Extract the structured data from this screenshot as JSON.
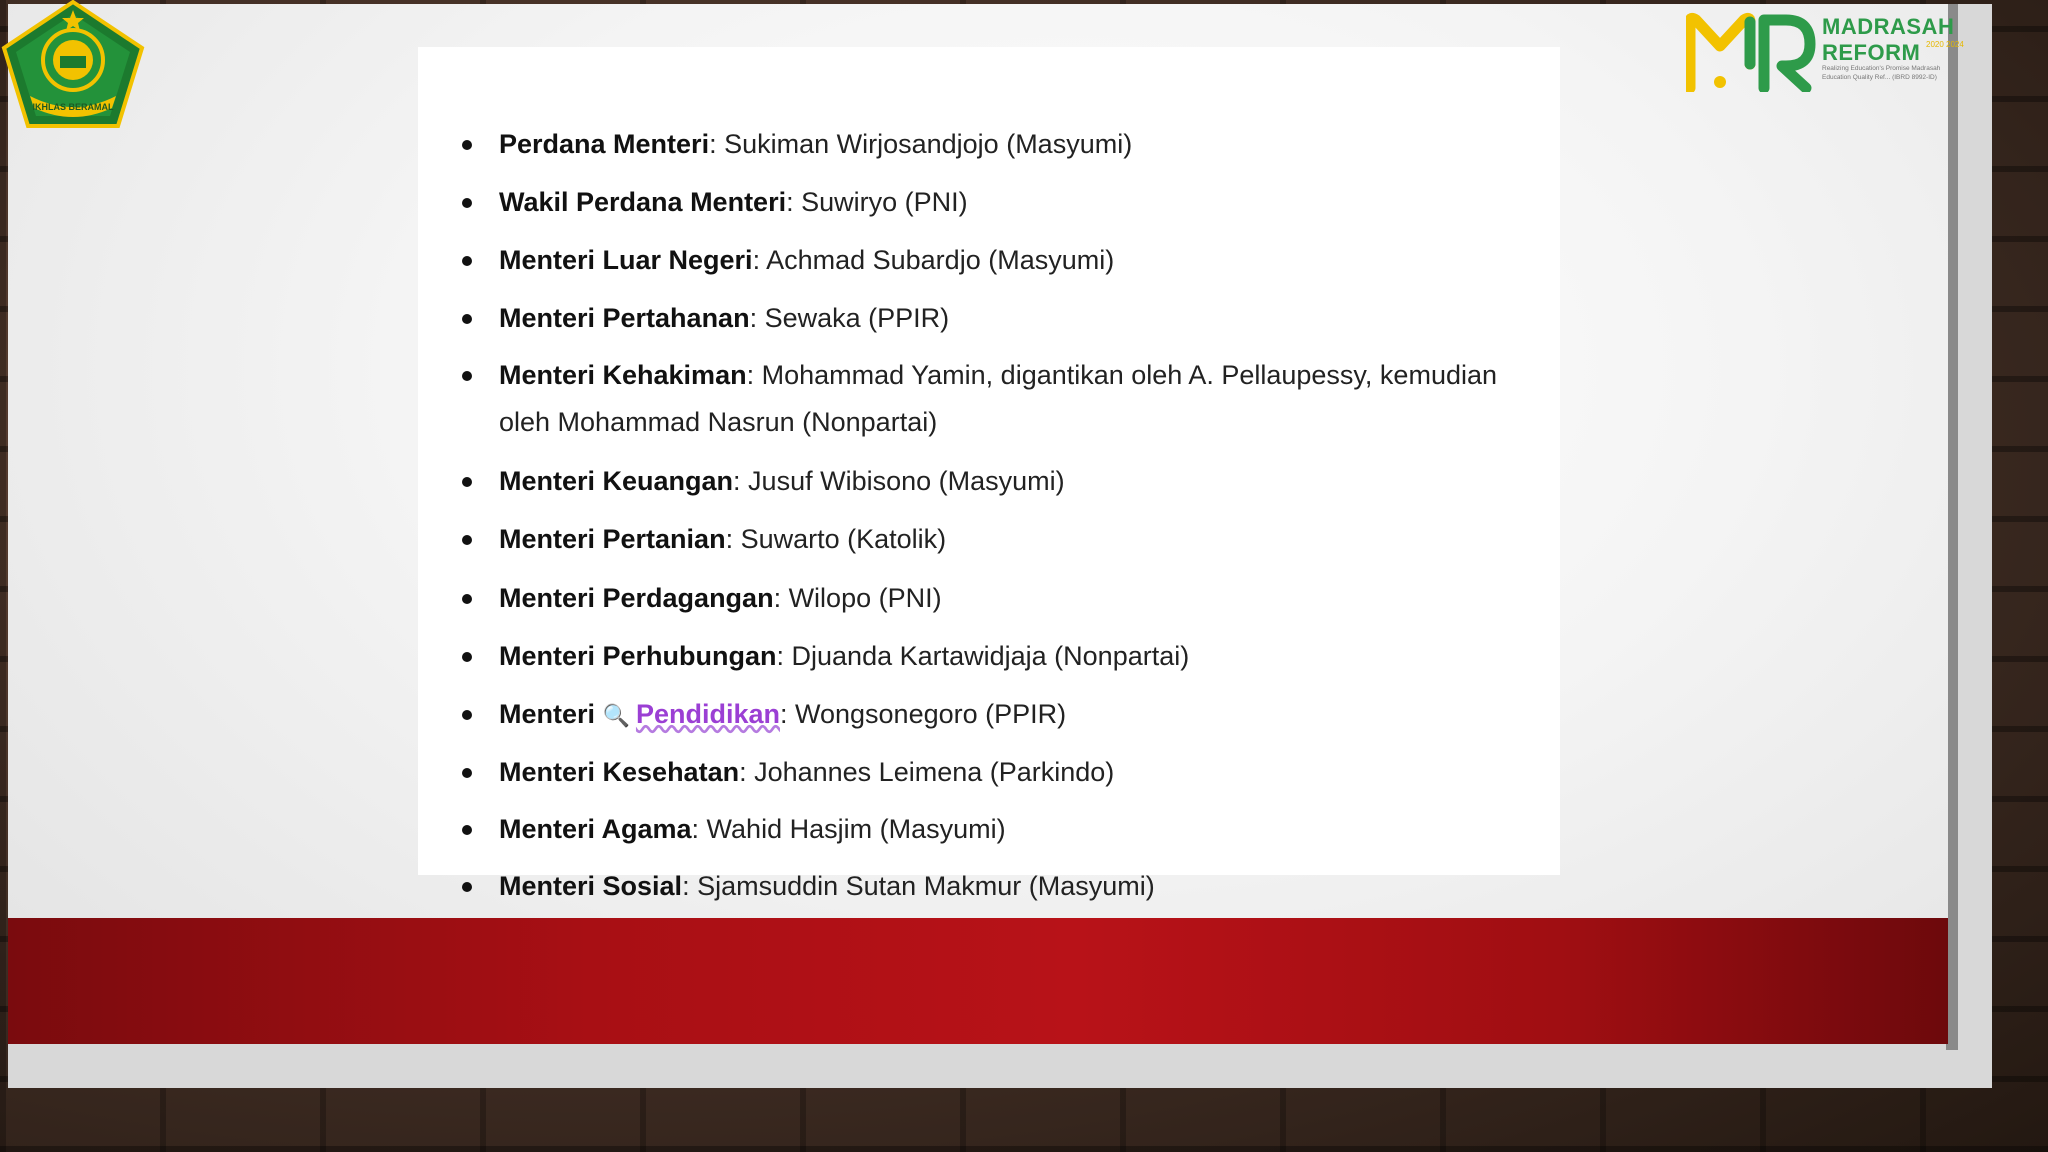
{
  "slide": {
    "ministers": [
      {
        "title": "Perdana Menteri",
        "detail": ": Sukiman Wirjosandjojo (Masyumi)"
      },
      {
        "title": "Wakil Perdana Menteri",
        "detail": ": Suwiryo (PNI)"
      },
      {
        "title": "Menteri Luar Negeri",
        "detail": ": Achmad Subardjo (Masyumi)"
      },
      {
        "title": "Menteri Pertahanan",
        "detail": ": Sewaka (PPIR)"
      },
      {
        "title": "Menteri Kehakiman",
        "detail": ": Mohammad Yamin, digantikan oleh A. Pellaupessy, kemudian oleh Mohammad Nasrun (Nonpartai)"
      },
      {
        "title": "Menteri Keuangan",
        "detail": ": Jusuf Wibisono (Masyumi)"
      },
      {
        "title": "Menteri Pertanian",
        "detail": ": Suwarto (Katolik)"
      },
      {
        "title": "Menteri Perdagangan",
        "detail": ": Wilopo (PNI)"
      },
      {
        "title": "Menteri Perhubungan",
        "detail": ": Djuanda Kartawidjaja (Nonpartai)"
      },
      {
        "title": "Menteri",
        "link": "Pendidikan",
        "detail": ": Wongsonegoro (PPIR)"
      },
      {
        "title": "Menteri Kesehatan",
        "detail": ": Johannes Leimena (Parkindo)"
      },
      {
        "title": "Menteri Agama",
        "detail": ": Wahid Hasjim (Masyumi)"
      },
      {
        "title": "Menteri Sosial",
        "detail": ": Sjamsuddin Sutan Makmur (Masyumi)"
      }
    ]
  },
  "logo_left": {
    "banner": "IKHLAS BERAMAL",
    "icon": "kemenag-emblem-icon"
  },
  "logo_right": {
    "title_line1": "MADRASAH",
    "title_line2": "REFORM",
    "years": "2020 2024",
    "subtitle": "Realizing Education's Promise Madrasah Education Quality Ref... (IBRD 8992-ID)",
    "icon": "mr-logo-icon"
  },
  "colors": {
    "red_band": "#b81218",
    "link": "#9b3fd4",
    "mr_green": "#2e9b4a",
    "mr_yellow": "#f2c200"
  }
}
